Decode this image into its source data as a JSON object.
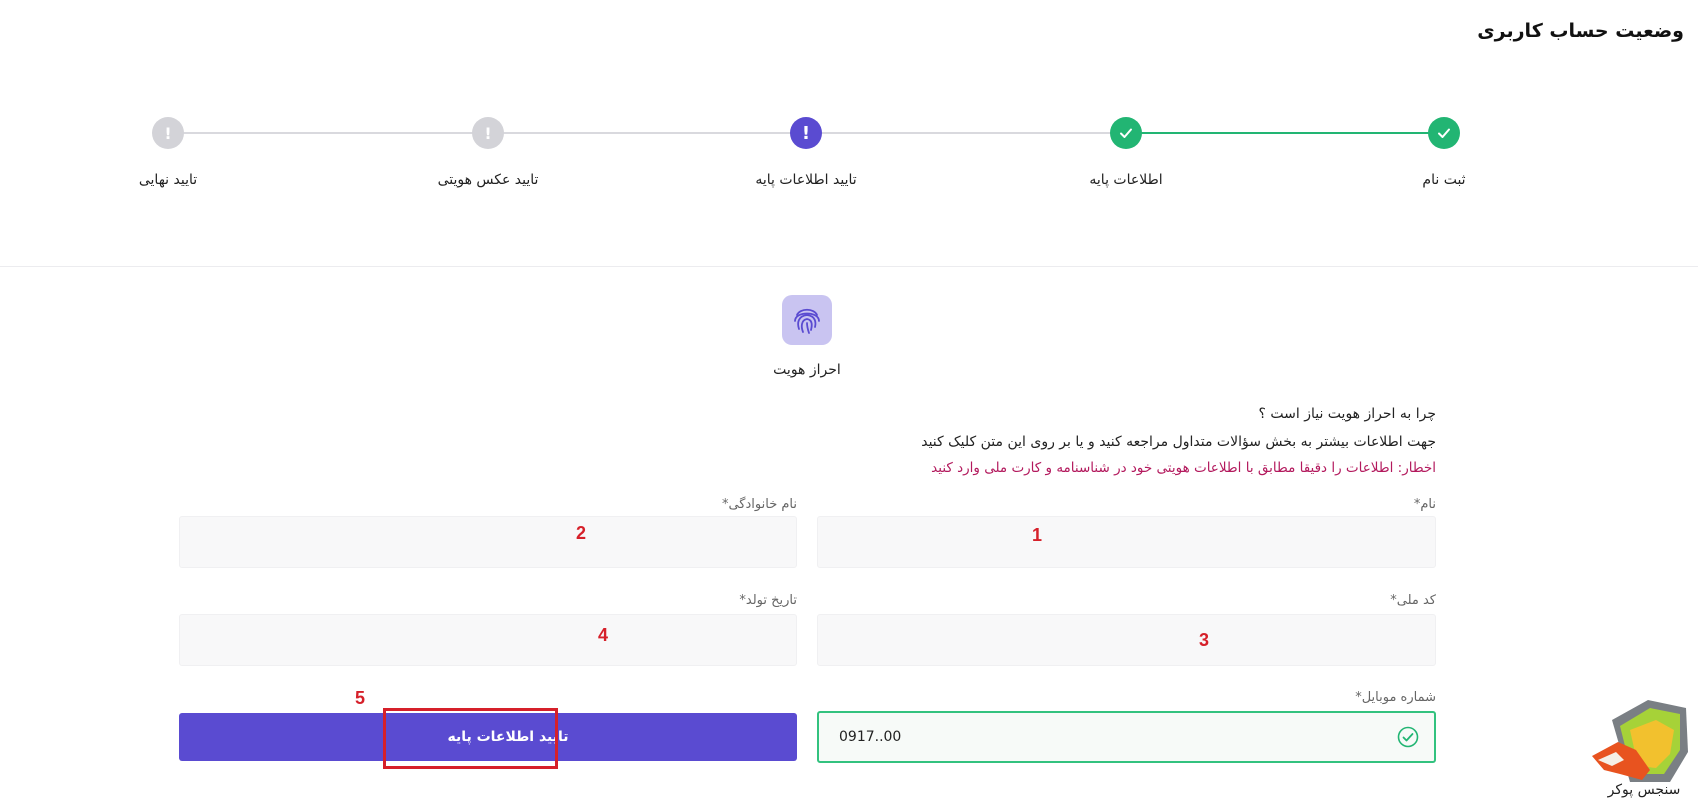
{
  "page_title": "وضعیت حساب کاربری",
  "stepper": {
    "steps": [
      {
        "label": "ثبت نام",
        "status": "done"
      },
      {
        "label": "اطلاعات پایه",
        "status": "done"
      },
      {
        "label": "تایید اطلاعات پایه",
        "status": "current"
      },
      {
        "label": "تایید عکس هویتی",
        "status": "pending"
      },
      {
        "label": "تایید نهایی",
        "status": "pending"
      }
    ],
    "pending_glyph": "!",
    "colors": {
      "done": "#22b573",
      "current": "#5a4bd1",
      "pending": "#d3d3d8"
    }
  },
  "identity": {
    "icon": "fingerprint-icon",
    "title": "احراز هویت"
  },
  "info": {
    "question": "چرا به احراز هویت نیاز است ؟",
    "more": "جهت اطلاعات بیشتر به بخش سؤالات متداول مراجعه کنید و یا بر روی این متن کلیک کنید",
    "warning": "اخطار: اطلاعات را دقیقا مطابق با اطلاعات هویتی خود در شناسنامه و کارت ملی وارد کنید"
  },
  "form": {
    "first_name": {
      "label": "نام*",
      "value": ""
    },
    "last_name": {
      "label": "نام خانوادگی*",
      "value": ""
    },
    "national_id": {
      "label": "کد ملی*",
      "value": ""
    },
    "birth_date": {
      "label": "تاریخ تولد*",
      "value": ""
    },
    "mobile": {
      "label": "شماره موبایل*",
      "value": "0917..00"
    },
    "submit_label": "تایید اطلاعات پایه"
  },
  "annotations": [
    "1",
    "2",
    "3",
    "4",
    "5"
  ],
  "brand": {
    "name": "سنجس پوکر",
    "accent": "#5a4bd1"
  }
}
